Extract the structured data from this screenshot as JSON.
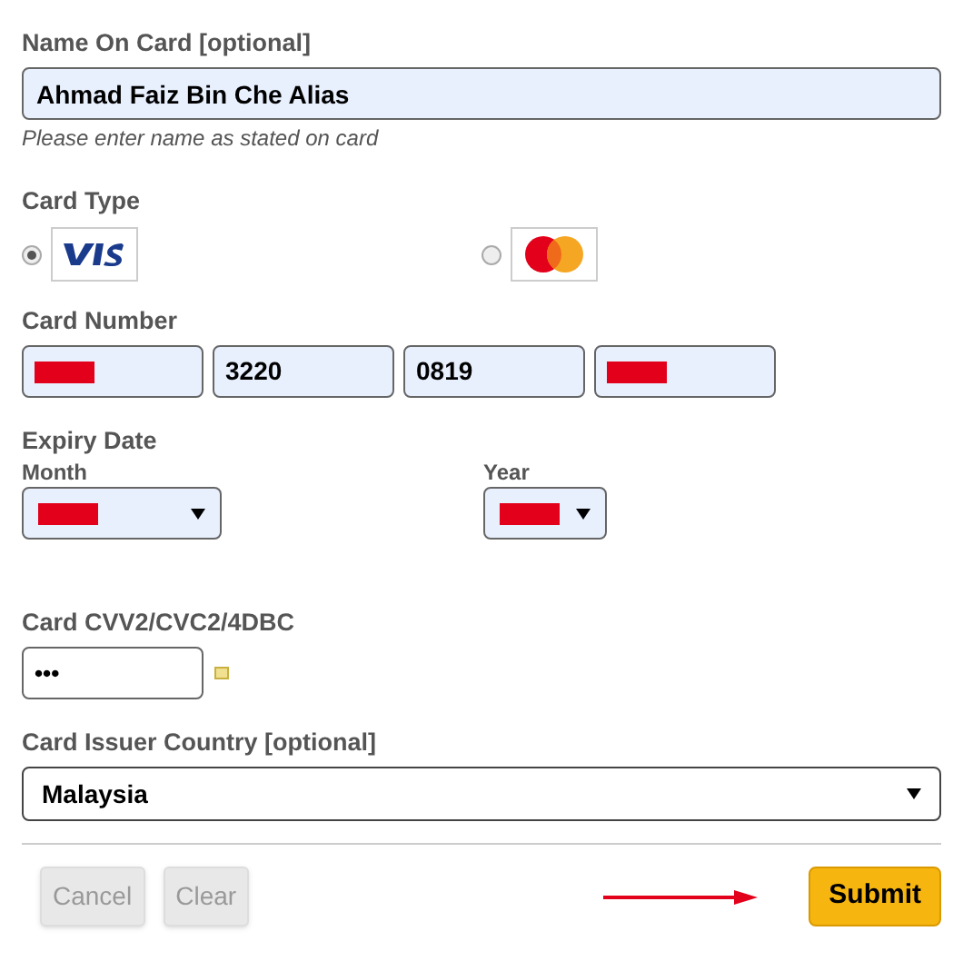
{
  "name_on_card": {
    "label": "Name On Card [optional]",
    "value": "Ahmad Faiz Bin Che Alias",
    "hint": "Please enter name as stated on card"
  },
  "card_type": {
    "label": "Card Type",
    "options": [
      {
        "kind": "visa",
        "selected": true
      },
      {
        "kind": "mastercard",
        "selected": false
      }
    ]
  },
  "card_number": {
    "label": "Card Number",
    "segments": [
      {
        "redacted": true
      },
      {
        "value": "3220",
        "redacted": false
      },
      {
        "value": "0819",
        "redacted": false
      },
      {
        "redacted": true
      }
    ]
  },
  "expiry": {
    "label": "Expiry Date",
    "month": {
      "label": "Month",
      "redacted": true
    },
    "year": {
      "label": "Year",
      "redacted": true
    }
  },
  "cvv": {
    "label": "Card CVV2/CVC2/4DBC",
    "value": "•••"
  },
  "country": {
    "label": "Card Issuer Country [optional]",
    "value": "Malaysia"
  },
  "buttons": [
    {
      "label": "Cancel",
      "kind": "secondary",
      "disabled": true
    },
    {
      "label": "Clear",
      "kind": "secondary",
      "disabled": true
    },
    {
      "label": "Submit",
      "kind": "primary",
      "disabled": false
    }
  ]
}
